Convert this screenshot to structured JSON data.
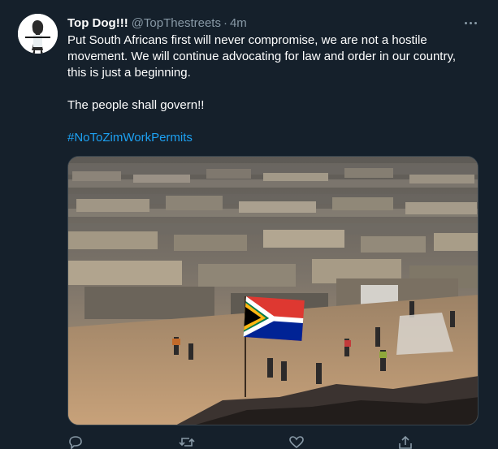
{
  "tweet": {
    "display_name": "Top Dog!!!",
    "handle": "@TopThestreets",
    "separator": "·",
    "time": "4m",
    "body_lines": [
      "Put South Africans first will never compromise, we are not a hostile",
      "movement. We will continue advocating for law and order in our country,",
      "this is just a beginning."
    ],
    "second_paragraph": "The people shall govern!!",
    "hashtag": "#NoToZimWorkPermits"
  },
  "icons": {
    "avatar": "avatar-image",
    "more": "more-options-icon",
    "reply": "reply-icon",
    "retweet": "retweet-icon",
    "like": "like-icon",
    "share": "share-icon"
  },
  "colors": {
    "background": "#15202b",
    "text": "#ffffff",
    "secondary": "#8899a6",
    "link": "#1da1f2"
  }
}
